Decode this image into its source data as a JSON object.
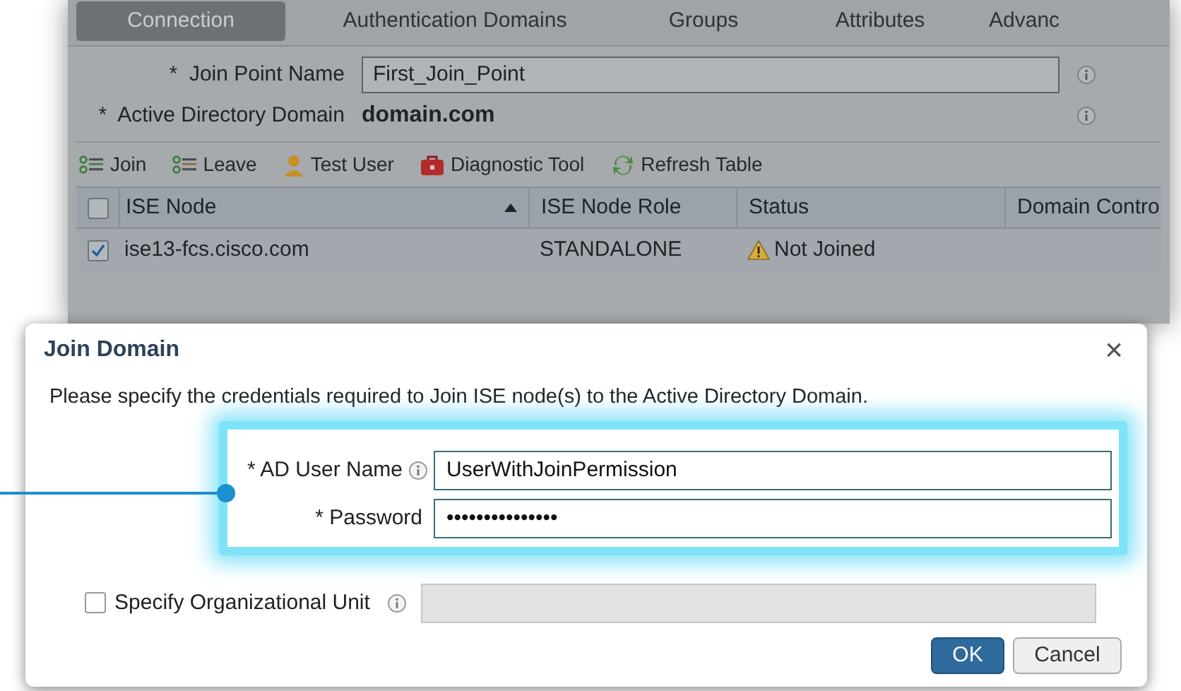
{
  "tabs": [
    {
      "label": "Connection",
      "selected": true
    },
    {
      "label": "Authentication Domains",
      "selected": false
    },
    {
      "label": "Groups",
      "selected": false
    },
    {
      "label": "Attributes",
      "selected": false
    },
    {
      "label": "Advanc",
      "selected": false
    }
  ],
  "join_point": {
    "label": "Join Point Name",
    "required": "*",
    "value": "First_Join_Point"
  },
  "ad_domain": {
    "label": "Active Directory Domain",
    "required": "*",
    "value": "domain.com"
  },
  "toolbar": [
    {
      "kind": "join",
      "label": "Join"
    },
    {
      "kind": "leave",
      "label": "Leave"
    },
    {
      "kind": "user",
      "label": "Test User"
    },
    {
      "kind": "tool",
      "label": "Diagnostic Tool"
    },
    {
      "kind": "refresh",
      "label": "Refresh Table"
    }
  ],
  "table": {
    "header_checked": false,
    "columns": [
      "ISE Node",
      "ISE Node Role",
      "Status",
      "Domain Contro"
    ],
    "rows": [
      {
        "checked": true,
        "node": "ise13-fcs.cisco.com",
        "role": "STANDALONE",
        "status": "Not Joined"
      }
    ]
  },
  "dialog": {
    "title": "Join Domain",
    "close": "×",
    "message": "Please specify the credentials required to Join ISE node(s) to the Active Directory Domain.",
    "username": {
      "label": "AD User Name",
      "required": "*",
      "value": "UserWithJoinPermission"
    },
    "password": {
      "label": "Password",
      "required": "*",
      "value": "•••••••••••••••"
    },
    "ou": {
      "label": "Specify Organizational Unit",
      "checked": false
    },
    "buttons": [
      {
        "kind": "primary",
        "label": "OK"
      },
      {
        "kind": "secondary",
        "label": "Cancel"
      }
    ]
  }
}
